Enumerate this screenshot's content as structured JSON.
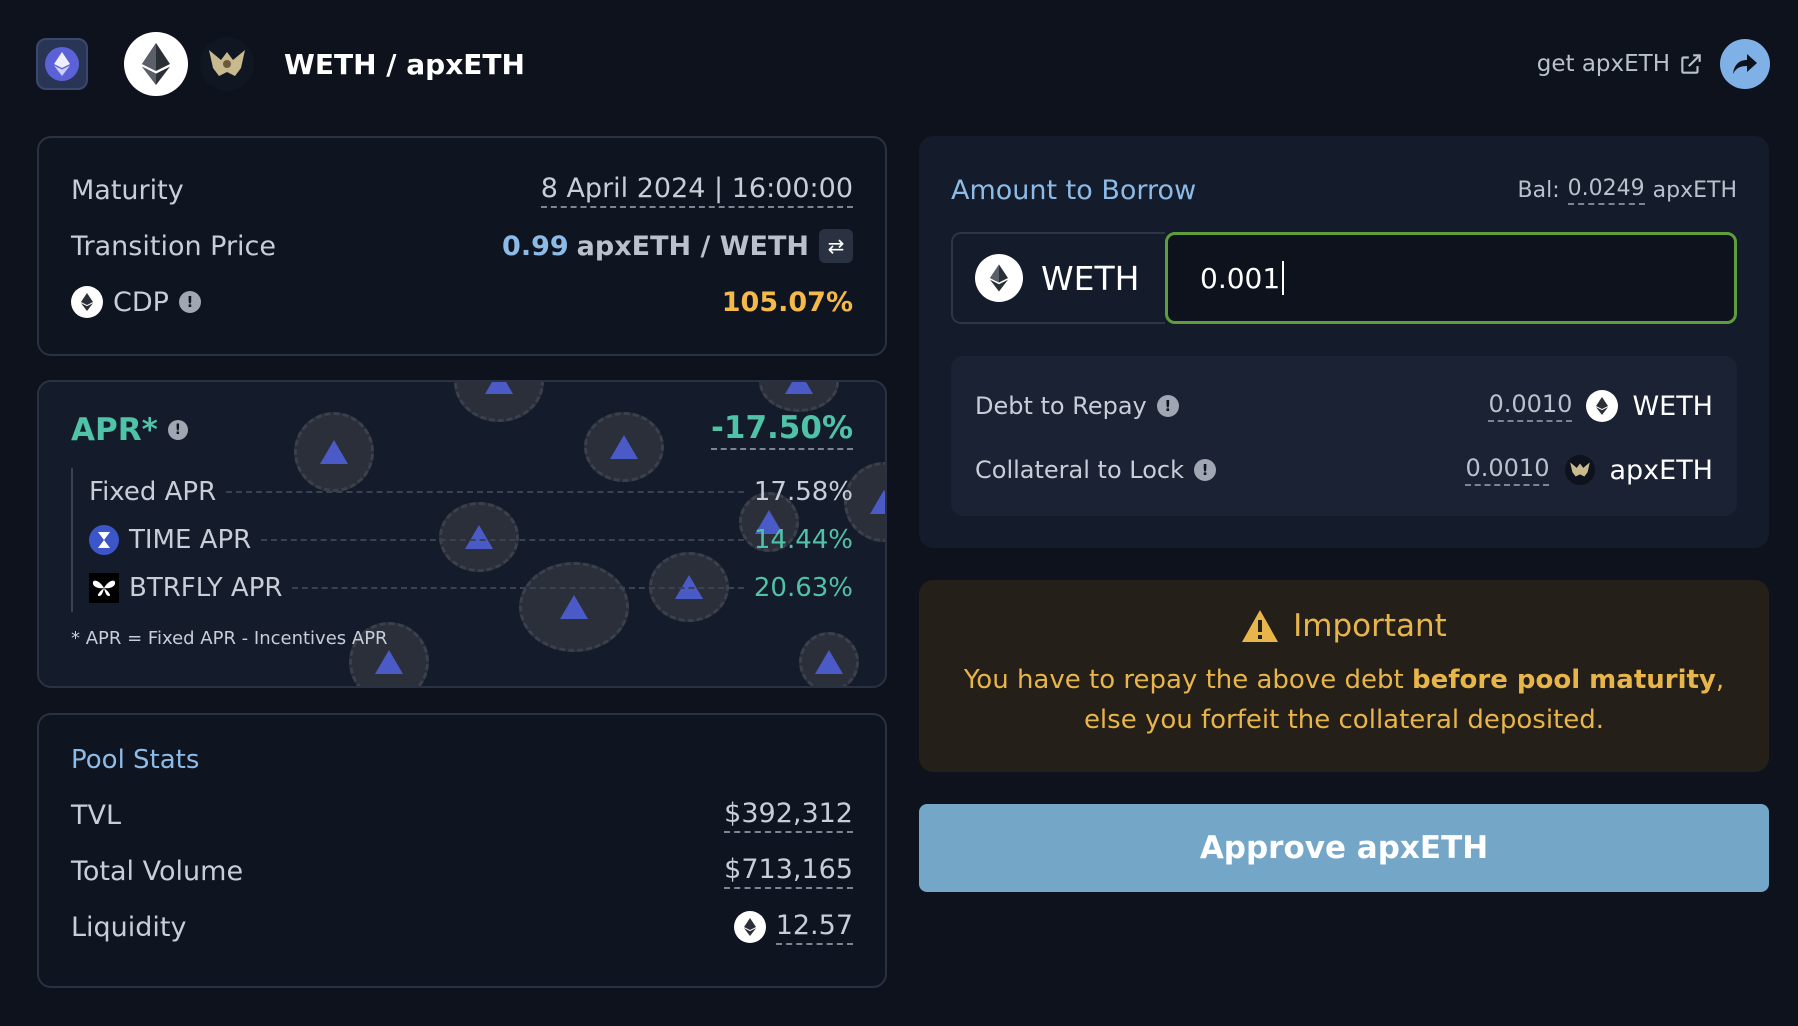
{
  "header": {
    "pair_title": "WETH / apxETH",
    "get_link": "get apxETH"
  },
  "info": {
    "maturity_label": "Maturity",
    "maturity_value": "8 April 2024 | 16:00:00",
    "transition_label": "Transition Price",
    "transition_value": "0.99",
    "transition_unit": "apxETH / WETH",
    "cdp_label": "CDP",
    "cdp_value": "105.07%"
  },
  "apr": {
    "title": "APR*",
    "total": "-17.50%",
    "lines": [
      {
        "label": "Fixed APR",
        "value": "17.58%"
      },
      {
        "label": "TIME APR",
        "value": "14.44%"
      },
      {
        "label": "BTRFLY APR",
        "value": "20.63%"
      }
    ],
    "note": "* APR = Fixed APR - Incentives APR"
  },
  "pool": {
    "title": "Pool Stats",
    "tvl_label": "TVL",
    "tvl_value": "$392,312",
    "volume_label": "Total Volume",
    "volume_value": "$713,165",
    "liquidity_label": "Liquidity",
    "liquidity_value": "12.57"
  },
  "borrow": {
    "title": "Amount to Borrow",
    "bal_label": "Bal:",
    "bal_value": "0.0249",
    "bal_unit": "apxETH",
    "token": "WETH",
    "amount": "0.001",
    "debt_label": "Debt to Repay",
    "debt_value": "0.0010",
    "debt_token": "WETH",
    "collateral_label": "Collateral to Lock",
    "collateral_value": "0.0010",
    "collateral_token": "apxETH"
  },
  "important": {
    "title": "Important",
    "text_pre": "You have to repay the above debt ",
    "text_bold": "before pool maturity",
    "text_post": ", else you forfeit the collateral deposited."
  },
  "actions": {
    "approve_label": "Approve apxETH"
  },
  "colors": {
    "background": "#0d121c",
    "accent_blue": "#8dbbe8",
    "accent_green": "#4fc2a8",
    "accent_orange": "#f5b94a",
    "input_border": "#5f9d3c",
    "approve_bg": "#74a6c8"
  }
}
